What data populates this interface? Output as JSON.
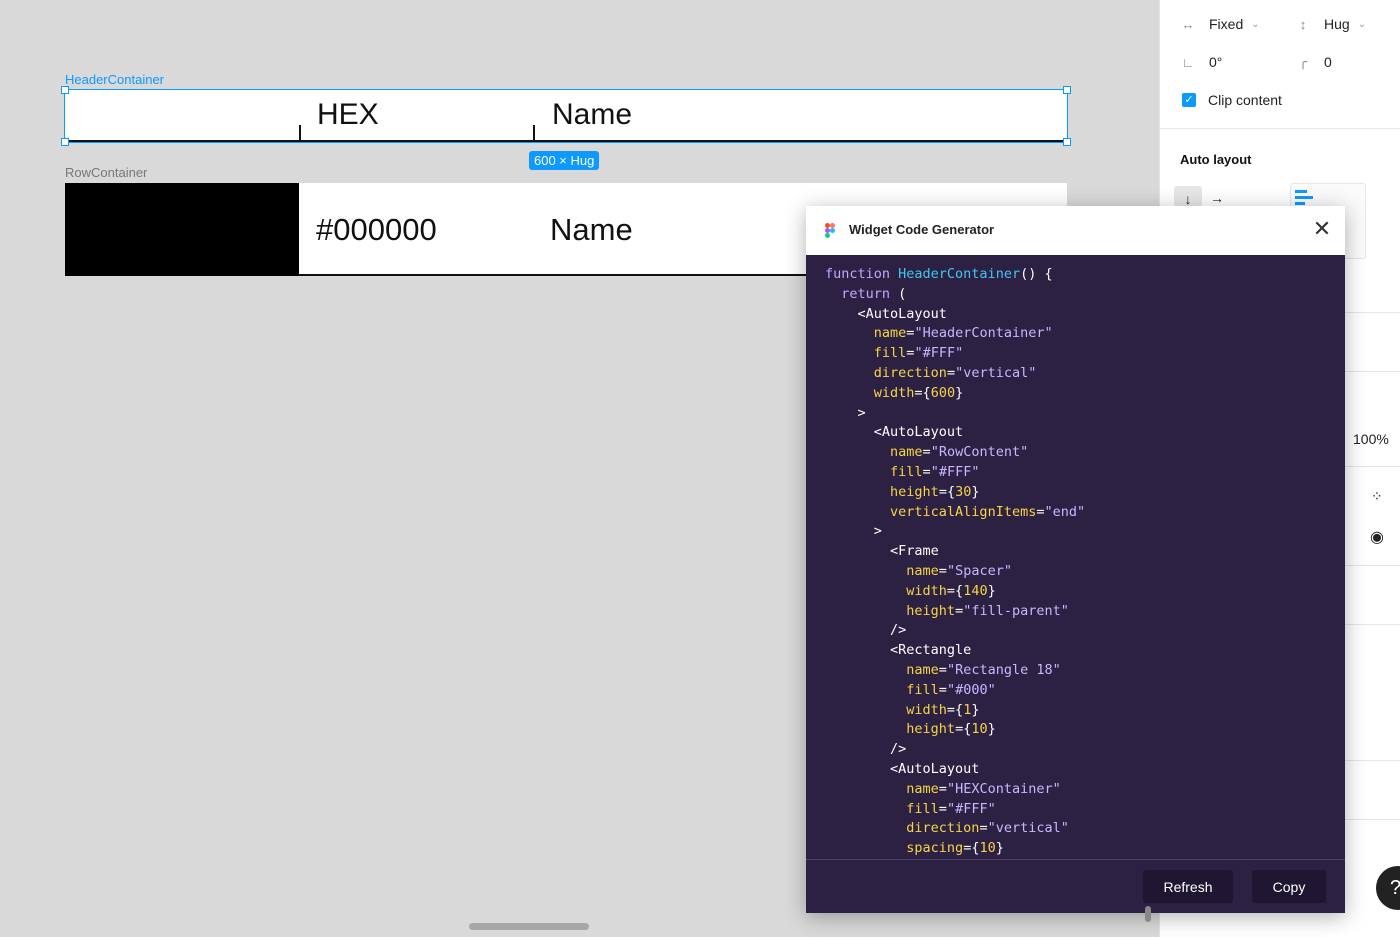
{
  "canvas": {
    "header_container_label": "HeaderContainer",
    "row_container_label": "RowContainer",
    "header_hex": "HEX",
    "header_name": "Name",
    "size_badge": "600 × Hug",
    "row_hex": "#000000",
    "row_name": "Name",
    "swatch_color": "#000000"
  },
  "props": {
    "width_mode": "Fixed",
    "height_mode": "Hug",
    "rotation": "0°",
    "radius": "0",
    "clip_content": "Clip content",
    "auto_layout_title": "Auto layout",
    "opacity": "100%"
  },
  "dialog": {
    "title": "Widget Code Generator",
    "refresh_label": "Refresh",
    "copy_label": "Copy",
    "code_lines": [
      [
        [
          "kw",
          "function "
        ],
        [
          "fn",
          "HeaderContainer"
        ],
        [
          "p",
          "() {"
        ]
      ],
      [
        [
          "p",
          "  "
        ],
        [
          "kw",
          "return"
        ],
        [
          "p",
          " ("
        ]
      ],
      [
        [
          "p",
          "    <"
        ],
        [
          "tag",
          "AutoLayout"
        ]
      ],
      [
        [
          "p",
          "      "
        ],
        [
          "at",
          "name"
        ],
        [
          "p",
          "="
        ],
        [
          "s",
          "\"HeaderContainer\""
        ]
      ],
      [
        [
          "p",
          "      "
        ],
        [
          "at",
          "fill"
        ],
        [
          "p",
          "="
        ],
        [
          "s",
          "\"#FFF\""
        ]
      ],
      [
        [
          "p",
          "      "
        ],
        [
          "at",
          "direction"
        ],
        [
          "p",
          "="
        ],
        [
          "s",
          "\"vertical\""
        ]
      ],
      [
        [
          "p",
          "      "
        ],
        [
          "at",
          "width"
        ],
        [
          "p",
          "={"
        ],
        [
          "n",
          "600"
        ],
        [
          "p",
          "}"
        ]
      ],
      [
        [
          "p",
          "    >"
        ]
      ],
      [
        [
          "p",
          "      <"
        ],
        [
          "tag",
          "AutoLayout"
        ]
      ],
      [
        [
          "p",
          "        "
        ],
        [
          "at",
          "name"
        ],
        [
          "p",
          "="
        ],
        [
          "s",
          "\"RowContent\""
        ]
      ],
      [
        [
          "p",
          "        "
        ],
        [
          "at",
          "fill"
        ],
        [
          "p",
          "="
        ],
        [
          "s",
          "\"#FFF\""
        ]
      ],
      [
        [
          "p",
          "        "
        ],
        [
          "at",
          "height"
        ],
        [
          "p",
          "={"
        ],
        [
          "n",
          "30"
        ],
        [
          "p",
          "}"
        ]
      ],
      [
        [
          "p",
          "        "
        ],
        [
          "at",
          "verticalAlignItems"
        ],
        [
          "p",
          "="
        ],
        [
          "s",
          "\"end\""
        ]
      ],
      [
        [
          "p",
          "      >"
        ]
      ],
      [
        [
          "p",
          "        <"
        ],
        [
          "tag",
          "Frame"
        ]
      ],
      [
        [
          "p",
          "          "
        ],
        [
          "at",
          "name"
        ],
        [
          "p",
          "="
        ],
        [
          "s",
          "\"Spacer\""
        ]
      ],
      [
        [
          "p",
          "          "
        ],
        [
          "at",
          "width"
        ],
        [
          "p",
          "={"
        ],
        [
          "n",
          "140"
        ],
        [
          "p",
          "}"
        ]
      ],
      [
        [
          "p",
          "          "
        ],
        [
          "at",
          "height"
        ],
        [
          "p",
          "="
        ],
        [
          "s",
          "\"fill-parent\""
        ]
      ],
      [
        [
          "p",
          "        />"
        ]
      ],
      [
        [
          "p",
          "        <"
        ],
        [
          "tag",
          "Rectangle"
        ]
      ],
      [
        [
          "p",
          "          "
        ],
        [
          "at",
          "name"
        ],
        [
          "p",
          "="
        ],
        [
          "s",
          "\"Rectangle 18\""
        ]
      ],
      [
        [
          "p",
          "          "
        ],
        [
          "at",
          "fill"
        ],
        [
          "p",
          "="
        ],
        [
          "s",
          "\"#000\""
        ]
      ],
      [
        [
          "p",
          "          "
        ],
        [
          "at",
          "width"
        ],
        [
          "p",
          "={"
        ],
        [
          "n",
          "1"
        ],
        [
          "p",
          "}"
        ]
      ],
      [
        [
          "p",
          "          "
        ],
        [
          "at",
          "height"
        ],
        [
          "p",
          "={"
        ],
        [
          "n",
          "10"
        ],
        [
          "p",
          "}"
        ]
      ],
      [
        [
          "p",
          "        />"
        ]
      ],
      [
        [
          "p",
          "        <"
        ],
        [
          "tag",
          "AutoLayout"
        ]
      ],
      [
        [
          "p",
          "          "
        ],
        [
          "at",
          "name"
        ],
        [
          "p",
          "="
        ],
        [
          "s",
          "\"HEXContainer\""
        ]
      ],
      [
        [
          "p",
          "          "
        ],
        [
          "at",
          "fill"
        ],
        [
          "p",
          "="
        ],
        [
          "s",
          "\"#FFF\""
        ]
      ],
      [
        [
          "p",
          "          "
        ],
        [
          "at",
          "direction"
        ],
        [
          "p",
          "="
        ],
        [
          "s",
          "\"vertical\""
        ]
      ],
      [
        [
          "p",
          "          "
        ],
        [
          "at",
          "spacing"
        ],
        [
          "p",
          "={"
        ],
        [
          "n",
          "10"
        ],
        [
          "p",
          "}"
        ]
      ]
    ]
  },
  "icons": {
    "width": "width-icon",
    "height": "height-icon",
    "rotation": "rotation-icon",
    "radius": "radius-icon",
    "close": "close-icon",
    "help": "?"
  },
  "colors": {
    "accent": "#0d99ff",
    "dialog_bg": "#2c2142"
  }
}
